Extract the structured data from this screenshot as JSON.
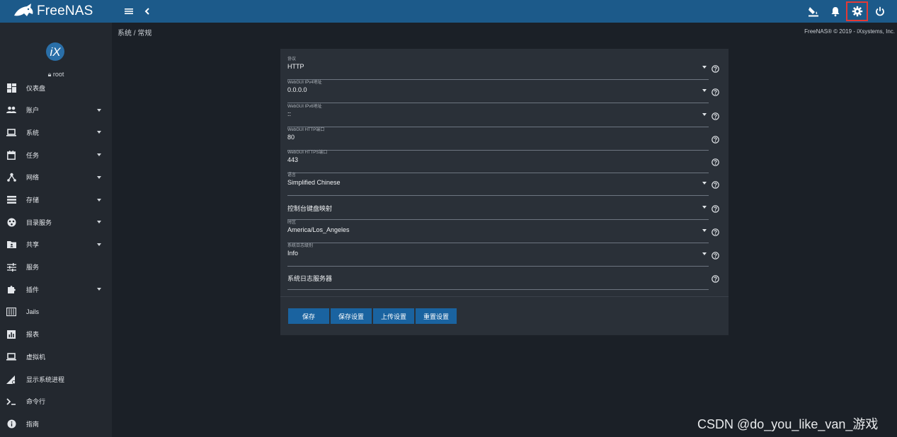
{
  "app": {
    "title": "FreeNAS"
  },
  "topbar": {
    "icons": [
      "menu-icon",
      "chevron-left-icon",
      "theme-icon",
      "bell-icon",
      "gear-icon",
      "power-icon"
    ]
  },
  "sidebar": {
    "avatar_text": "iX",
    "user": "root",
    "items": [
      {
        "label": "仪表盘",
        "icon": "dashboard-icon",
        "expandable": false
      },
      {
        "label": "账户",
        "icon": "group-icon",
        "expandable": true
      },
      {
        "label": "系统",
        "icon": "laptop-icon",
        "expandable": true
      },
      {
        "label": "任务",
        "icon": "calendar-icon",
        "expandable": true
      },
      {
        "label": "网络",
        "icon": "network-icon",
        "expandable": true
      },
      {
        "label": "存储",
        "icon": "storage-icon",
        "expandable": true
      },
      {
        "label": "目录服务",
        "icon": "directory-icon",
        "expandable": true
      },
      {
        "label": "共享",
        "icon": "folder-share-icon",
        "expandable": true
      },
      {
        "label": "服务",
        "icon": "tune-icon",
        "expandable": false
      },
      {
        "label": "插件",
        "icon": "puzzle-icon",
        "expandable": true
      },
      {
        "label": "Jails",
        "icon": "jail-icon",
        "expandable": false
      },
      {
        "label": "报表",
        "icon": "chart-icon",
        "expandable": false
      },
      {
        "label": "虚拟机",
        "icon": "vm-icon",
        "expandable": false
      },
      {
        "label": "显示系统进程",
        "icon": "signal-icon",
        "expandable": false
      },
      {
        "label": "命令行",
        "icon": "terminal-icon",
        "expandable": false
      },
      {
        "label": "指南",
        "icon": "info-icon",
        "expandable": false
      }
    ]
  },
  "breadcrumb": {
    "text": "系统 /  常规"
  },
  "copyright": "FreeNAS® © 2019 - iXsystems, Inc.",
  "form": {
    "fields": [
      {
        "label": "协议",
        "value": "HTTP",
        "type": "select"
      },
      {
        "label": "WebGUI IPv4地址",
        "value": "0.0.0.0",
        "type": "select"
      },
      {
        "label": "WebGUI IPv6地址",
        "value": "::",
        "type": "select"
      },
      {
        "label": "WebGUI HTTP端口",
        "value": "80",
        "type": "input"
      },
      {
        "label": "WebGUI HTTPS端口",
        "value": "443",
        "type": "input"
      },
      {
        "label": "语言",
        "value": "Simplified Chinese",
        "type": "select"
      },
      {
        "label": "",
        "value": "控制台键盘映射",
        "type": "select"
      },
      {
        "label": "时区",
        "value": "America/Los_Angeles",
        "type": "select"
      },
      {
        "label": "系统日志级别",
        "value": "Info",
        "type": "select"
      },
      {
        "label": "",
        "value": "系统日志服务器",
        "type": "input"
      }
    ],
    "buttons": [
      {
        "label": "保存"
      },
      {
        "label": "保存设置"
      },
      {
        "label": "上传设置"
      },
      {
        "label": "重置设置"
      }
    ]
  },
  "watermark": "CSDN @do_you_like_van_游戏"
}
